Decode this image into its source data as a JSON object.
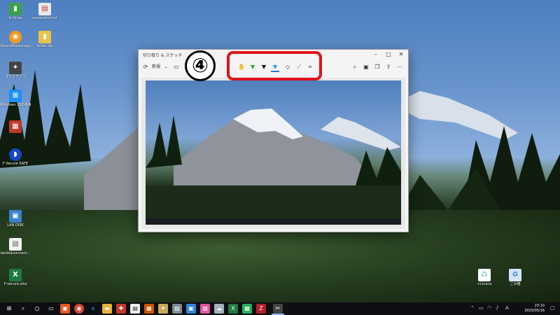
{
  "desktop_icons": [
    {
      "label": "G-Drive",
      "icon": "folder-green-icon",
      "color": "#3aa04a"
    },
    {
      "label": "screenshot.txt",
      "icon": "text-file-icon",
      "color": "#e8e8e8"
    },
    {
      "label": "SoundBlasterapp",
      "icon": "orange-app-icon",
      "color": "#f29a1d"
    },
    {
      "label": "folder.zip",
      "icon": "zip-folder-icon",
      "color": "#e8c34a"
    },
    {
      "label": "スマホアプリ",
      "icon": "phone-app-icon",
      "color": "#444444"
    },
    {
      "label": "Windows 10の新機能 ヘルプ",
      "icon": "windows-icon",
      "color": "#1e90ff"
    },
    {
      "label": "",
      "icon": "ticket-app-icon",
      "color": "#c0392b"
    },
    {
      "label": "F-Secure SAFE",
      "icon": "fsecure-icon",
      "color": "#1746c6"
    },
    {
      "label": "LAN DISK",
      "icon": "lan-disk-icon",
      "color": "#3a80d0"
    },
    {
      "label": "landiskconnect...",
      "icon": "note-file-icon",
      "color": "#f5f5f5"
    },
    {
      "label": "F-secure.xlsx",
      "icon": "excel-file-icon",
      "color": "#1f7a3f"
    }
  ],
  "right_icons": [
    {
      "label": "+Linaca",
      "icon": "recycle-app-icon"
    },
    {
      "label": "ごみ箱",
      "icon": "recycle-bin-icon"
    }
  ],
  "window": {
    "title": "切り取り & スケッチ",
    "new_label": "新規",
    "tools_left": [
      "new-snip",
      "dropdown",
      "open-folder"
    ],
    "annotation_tools": [
      "touch-writing",
      "ballpoint-pen",
      "pencil",
      "highlighter",
      "eraser",
      "ruler",
      "crop"
    ],
    "tools_right": [
      "zoom",
      "save",
      "copy",
      "share",
      "more"
    ]
  },
  "annotation": {
    "number": "④",
    "box_color": "#e0121a"
  },
  "taskbar": {
    "time": "23:10",
    "date": "2020/05/16",
    "ime": "A",
    "apps": [
      "file-explorer",
      "edge",
      "chrome",
      "edge-legacy",
      "explorer",
      "app-red",
      "app-white",
      "app-cards",
      "app-puzzle",
      "app-picture",
      "app-blue",
      "app-pink",
      "app-cloud",
      "excel",
      "app-green",
      "filezilla",
      "snip-sketch"
    ]
  }
}
